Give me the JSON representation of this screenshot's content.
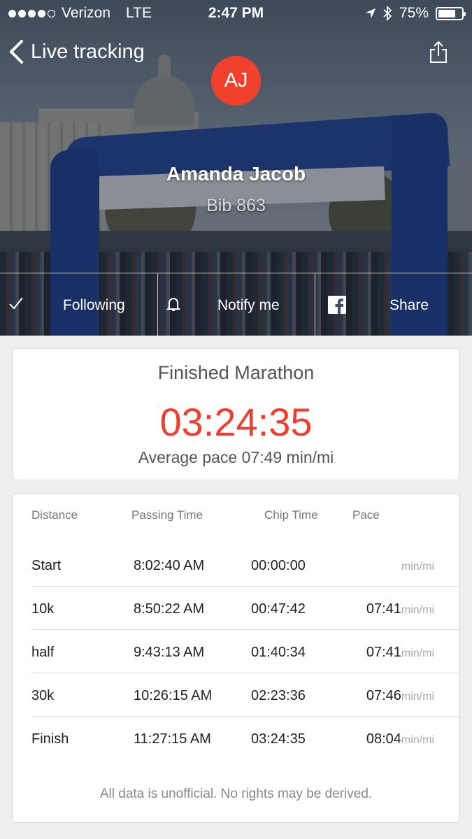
{
  "status_bar": {
    "carrier": "Verizon",
    "network": "LTE",
    "time": "2:47 PM",
    "battery": "75%",
    "battery_level": 0.75
  },
  "nav": {
    "back_label": "Live tracking",
    "share_icon": "share-icon"
  },
  "runner": {
    "initials": "AJ",
    "name": "Amanda Jacob",
    "bib": "Bib 863",
    "avatar_color": "#f0412c"
  },
  "actions": [
    {
      "label": "Following",
      "icon": "checkmark-icon"
    },
    {
      "label": "Notify me",
      "icon": "bell-icon"
    },
    {
      "label": "Share",
      "icon": "facebook-icon"
    }
  ],
  "finish": {
    "title": "Finished Marathon",
    "time": "03:24:35",
    "pace": "Average pace 07:49 min/mi",
    "accent_color": "#ee3f30"
  },
  "splits": {
    "headers": [
      "Distance",
      "Passing Time",
      "Chip Time",
      "Pace"
    ],
    "rows": [
      {
        "distance": "Start",
        "passing": "8:02:40 AM",
        "chip": "00:00:00",
        "pace": "",
        "unit": "min/mi"
      },
      {
        "distance": "10k",
        "passing": "8:50:22 AM",
        "chip": "00:47:42",
        "pace": "07:41",
        "unit": "min/mi"
      },
      {
        "distance": "half",
        "passing": "9:43:13 AM",
        "chip": "01:40:34",
        "pace": "07:41",
        "unit": "min/mi"
      },
      {
        "distance": "30k",
        "passing": "10:26:15 AM",
        "chip": "02:23:36",
        "pace": "07:46",
        "unit": "min/mi"
      },
      {
        "distance": "Finish",
        "passing": "11:27:15 AM",
        "chip": "03:24:35",
        "pace": "08:04",
        "unit": "min/mi"
      }
    ],
    "disclaimer": "All data is unofficial. No rights may be derived."
  }
}
